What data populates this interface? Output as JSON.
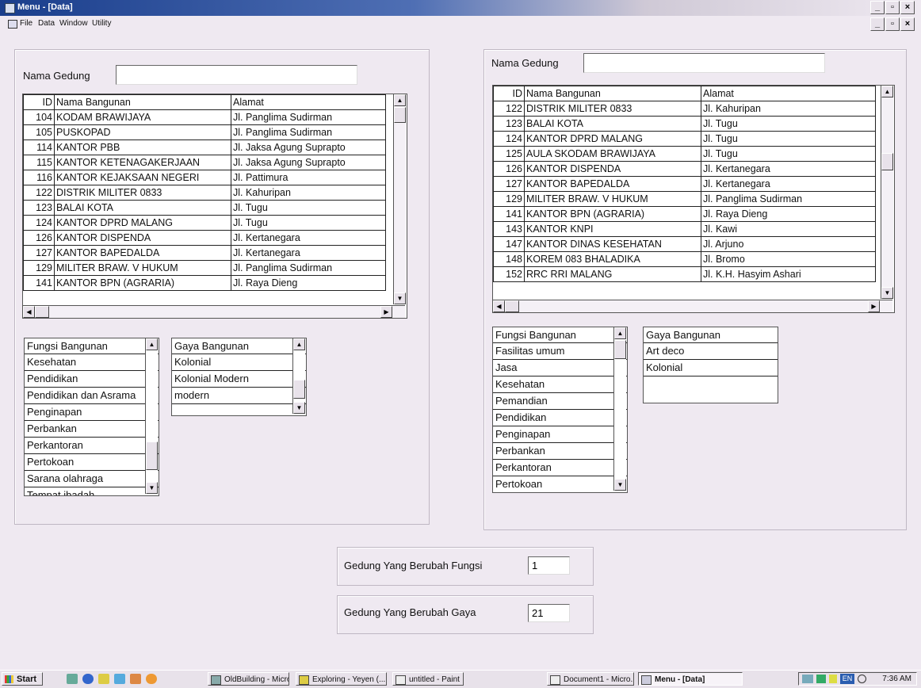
{
  "window": {
    "title": "Menu - [Data]"
  },
  "menu": [
    "File",
    "Data",
    "Window",
    "Utility"
  ],
  "left": {
    "nama_gedung_label": "Nama Gedung",
    "nama_gedung_value": "",
    "grid_headers": [
      "ID",
      "Nama Bangunan",
      "Alamat"
    ],
    "grid_rows": [
      [
        "104",
        "KODAM BRAWIJAYA",
        "Jl. Panglima Sudirman"
      ],
      [
        "105",
        "PUSKOPAD",
        "Jl. Panglima Sudirman"
      ],
      [
        "114",
        "KANTOR PBB",
        "Jl. Jaksa Agung Suprapto"
      ],
      [
        "115",
        "KANTOR KETENAGAKERJAAN",
        "Jl. Jaksa Agung Suprapto"
      ],
      [
        "116",
        "KANTOR KEJAKSAAN NEGERI",
        "Jl. Pattimura"
      ],
      [
        "122",
        "DISTRIK MILITER 0833",
        "Jl. Kahuripan"
      ],
      [
        "123",
        "BALAI KOTA",
        "Jl. Tugu"
      ],
      [
        "124",
        "KANTOR DPRD MALANG",
        "Jl. Tugu"
      ],
      [
        "126",
        "KANTOR DISPENDA",
        "Jl. Kertanegara"
      ],
      [
        "127",
        "KANTOR BAPEDALDA",
        "Jl. Kertanegara"
      ],
      [
        "129",
        "MILITER BRAW. V HUKUM",
        "Jl. Panglima Sudirman"
      ],
      [
        "141",
        "KANTOR BPN (AGRARIA)",
        "Jl. Raya Dieng"
      ]
    ],
    "fungsi_header": "Fungsi Bangunan",
    "fungsi_items": [
      "Kesehatan",
      "Pendidikan",
      "Pendidikan dan Asrama",
      "Penginapan",
      "Perbankan",
      "Perkantoran",
      "Pertokoan",
      "Sarana olahraga",
      "Tempat ibadah"
    ],
    "gaya_header": "Gaya Bangunan",
    "gaya_items": [
      "Kolonial",
      "Kolonial Modern",
      "modern"
    ]
  },
  "right": {
    "nama_gedung_label": "Nama Gedung",
    "nama_gedung_value": "",
    "grid_headers": [
      "ID",
      "Nama Bangunan",
      "Alamat"
    ],
    "grid_rows": [
      [
        "122",
        "DISTRIK MILITER 0833",
        "Jl. Kahuripan"
      ],
      [
        "123",
        "BALAI KOTA",
        "Jl. Tugu"
      ],
      [
        "124",
        "KANTOR DPRD MALANG",
        "Jl. Tugu"
      ],
      [
        "125",
        "AULA SKODAM BRAWIJAYA",
        "Jl. Tugu"
      ],
      [
        "126",
        "KANTOR DISPENDA",
        "Jl. Kertanegara"
      ],
      [
        "127",
        "KANTOR BAPEDALDA",
        "Jl. Kertanegara"
      ],
      [
        "129",
        "MILITER BRAW. V HUKUM",
        "Jl. Panglima Sudirman"
      ],
      [
        "141",
        "KANTOR BPN (AGRARIA)",
        "Jl. Raya Dieng"
      ],
      [
        "143",
        "KANTOR KNPI",
        "Jl. Kawi"
      ],
      [
        "147",
        "KANTOR DINAS KESEHATAN",
        "Jl. Arjuno"
      ],
      [
        "148",
        "KOREM 083 BHALADIKA",
        "Jl. Bromo"
      ],
      [
        "152",
        "RRC RRI MALANG",
        "Jl. K.H. Hasyim Ashari"
      ]
    ],
    "fungsi_header": "Fungsi Bangunan",
    "fungsi_items": [
      "Fasilitas umum",
      "Jasa",
      "Kesehatan",
      "Pemandian",
      "Pendidikan",
      "Penginapan",
      "Perbankan",
      "Perkantoran",
      "Pertokoan"
    ],
    "gaya_header": "Gaya Bangunan",
    "gaya_items": [
      "Art deco",
      "Kolonial"
    ]
  },
  "summary": {
    "fungsi_label": "Gedung Yang Berubah Fungsi",
    "fungsi_value": "1",
    "gaya_label": "Gedung Yang Berubah Gaya",
    "gaya_value": "21"
  },
  "taskbar": {
    "start": "Start",
    "items": [
      "OldBuilding - Micro...",
      "Exploring - Yeyen (...",
      "untitled - Paint",
      "Document1 - Micro...",
      "Menu - [Data]"
    ],
    "tray_lang": "EN",
    "clock": "7:36 AM"
  }
}
